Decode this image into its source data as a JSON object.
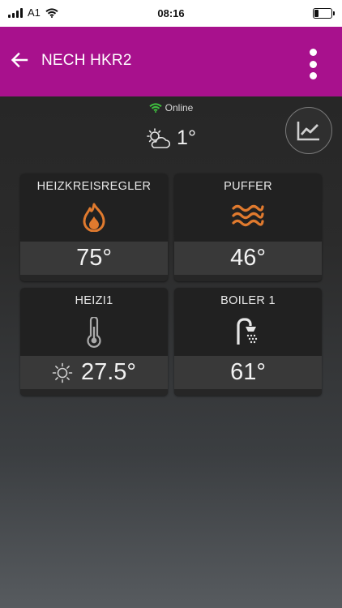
{
  "status_bar": {
    "carrier": "A1",
    "time": "08:16"
  },
  "app_bar": {
    "title": "NECH HKR2",
    "back_icon": "arrow-left-icon",
    "menu_icon": "more-vertical-icon",
    "background_color": "#a8118d"
  },
  "connection": {
    "status": "Online",
    "icon": "wifi-icon",
    "color": "#3fbf3f"
  },
  "weather": {
    "icon": "sun-cloud-icon",
    "temperature": "1°"
  },
  "chart_button": {
    "icon": "line-chart-icon"
  },
  "tiles": [
    {
      "title": "HEIZKREISREGLER",
      "icon": "flame-icon",
      "value": "75°"
    },
    {
      "title": "PUFFER",
      "icon": "heat-waves-icon",
      "value": "46°"
    },
    {
      "title": "HEIZI1",
      "icon": "thermometer-icon",
      "value": "27.5°",
      "mode_icon": "sun-mode-icon"
    },
    {
      "title": "BOILER 1",
      "icon": "shower-icon",
      "value": "61°"
    }
  ],
  "accent_colors": {
    "icon_orange": "#e07a2e"
  }
}
